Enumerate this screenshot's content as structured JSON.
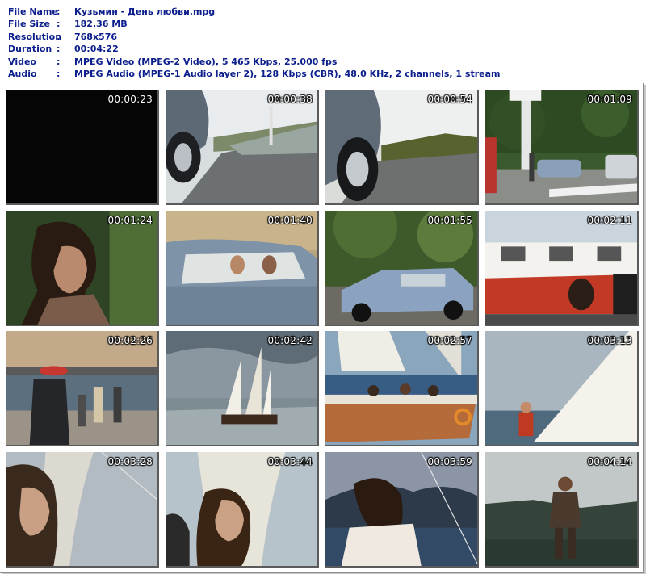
{
  "info": {
    "rows": [
      {
        "label": "File Name",
        "value": "Кузьмин - День любви.mpg"
      },
      {
        "label": "File Size",
        "value": "182.36 MB"
      },
      {
        "label": "Resolution",
        "value": "768x576"
      },
      {
        "label": "Duration",
        "value": "00:04:22"
      },
      {
        "label": "Video",
        "value": "MPEG Video (MPEG-2 Video), 5 465 Kbps, 25.000 fps"
      },
      {
        "label": "Audio",
        "value": "MPEG Audio (MPEG-1 Audio layer 2), 128 Kbps (CBR), 48.0 KHz, 2 channels, 1 stream"
      }
    ],
    "separator": ":"
  },
  "thumbnails": [
    {
      "time": "00:00:23",
      "scene": "black"
    },
    {
      "time": "00:00:38",
      "scene": "car-road"
    },
    {
      "time": "00:00:54",
      "scene": "car-road-2"
    },
    {
      "time": "00:01:09",
      "scene": "street-cars"
    },
    {
      "time": "00:01:24",
      "scene": "woman-profile"
    },
    {
      "time": "00:01:40",
      "scene": "couple-in-car"
    },
    {
      "time": "00:01:55",
      "scene": "car-driving"
    },
    {
      "time": "00:02:11",
      "scene": "ship-dock"
    },
    {
      "time": "00:02:26",
      "scene": "pier-people"
    },
    {
      "time": "00:02:42",
      "scene": "sailboat-sea"
    },
    {
      "time": "00:02:57",
      "scene": "yacht-crew"
    },
    {
      "time": "00:03:13",
      "scene": "sail-man"
    },
    {
      "time": "00:03:28",
      "scene": "woman-sail"
    },
    {
      "time": "00:03:44",
      "scene": "woman-sail-2"
    },
    {
      "time": "00:03:59",
      "scene": "woman-mountains"
    },
    {
      "time": "00:04:14",
      "scene": "man-cliff"
    }
  ],
  "colors": {
    "info_text": "#0b1e8c",
    "sheet_border": "#8c8c8c"
  }
}
